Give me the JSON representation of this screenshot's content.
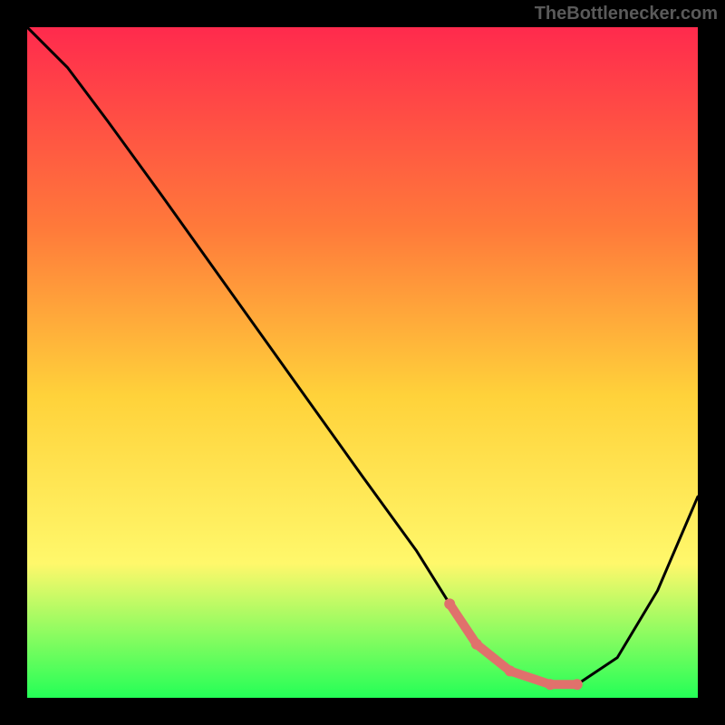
{
  "attribution": "TheBottlenecker.com",
  "colors": {
    "frame": "#000000",
    "gradient_top": "#ff2a4d",
    "gradient_mid_upper": "#ff7a3a",
    "gradient_mid": "#ffd23a",
    "gradient_mid_lower": "#fff86b",
    "gradient_bottom": "#24ff57",
    "curve": "#000000",
    "highlight": "#e0716c"
  },
  "chart_data": {
    "type": "line",
    "title": "",
    "xlabel": "",
    "ylabel": "",
    "xlim": [
      0,
      100
    ],
    "ylim": [
      0,
      100
    ],
    "series": [
      {
        "name": "curve",
        "x": [
          0,
          6,
          12,
          20,
          30,
          40,
          50,
          58,
          63,
          67,
          72,
          78,
          82,
          88,
          94,
          100
        ],
        "y": [
          100,
          94,
          86,
          75,
          61,
          47,
          33,
          22,
          14,
          8,
          4,
          2,
          2,
          6,
          16,
          30
        ]
      }
    ],
    "highlight_segment": {
      "x": [
        63,
        67,
        72,
        78,
        82
      ],
      "y": [
        14,
        8,
        4,
        2,
        2
      ]
    }
  }
}
